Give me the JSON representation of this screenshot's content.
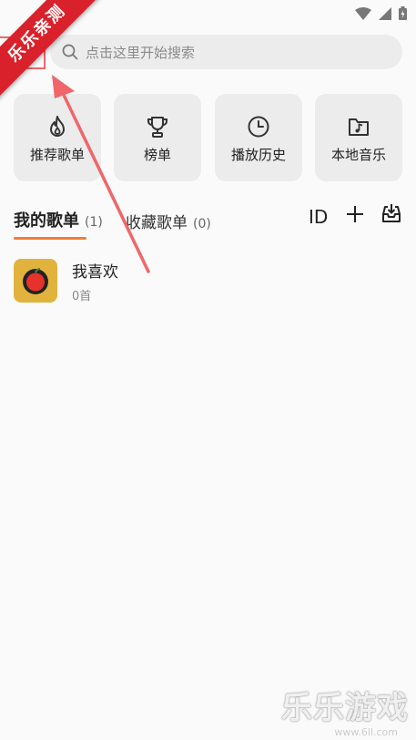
{
  "search": {
    "placeholder": "点击这里开始搜索"
  },
  "quick_actions": [
    {
      "label": "推荐歌单",
      "icon": "fire-icon"
    },
    {
      "label": "榜单",
      "icon": "trophy-icon"
    },
    {
      "label": "播放历史",
      "icon": "clock-icon"
    },
    {
      "label": "本地音乐",
      "icon": "music-folder-icon"
    }
  ],
  "tabs": {
    "my_playlists": {
      "label": "我的歌单",
      "count": "(1)"
    },
    "fav_playlists": {
      "label": "收藏歌单",
      "count": "(0)"
    }
  },
  "toolbar": {
    "id_label": "ID"
  },
  "playlists": [
    {
      "name": "我喜欢",
      "count": "0首"
    }
  ],
  "watermark": {
    "corner": "乐乐亲测",
    "bottom": "乐乐游戏",
    "url": "www.6ll.com"
  },
  "colors": {
    "accent": "#f07c3a",
    "watermark_red": "#d8212a",
    "cover": "#e2b33c"
  }
}
